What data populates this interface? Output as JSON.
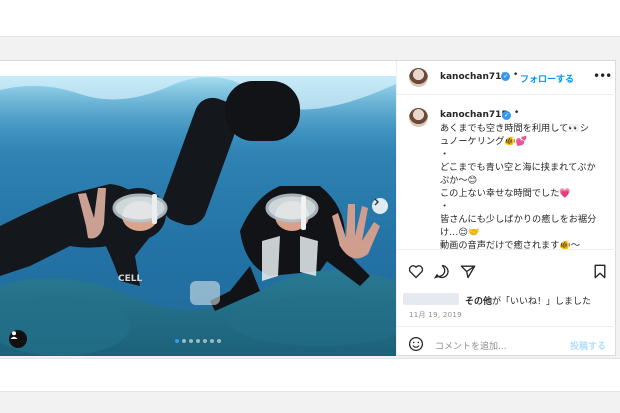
{
  "post": {
    "username": "kanochan715",
    "dot": "•",
    "follow_label": "フォローする",
    "more_label": "•••",
    "caption_lines": [
      "あくまでも空き時間を利用して👀シ",
      "ュノーケリング🐠💕",
      "・",
      "どこまでも青い空と海に挟まれてぷか",
      "ぷか〜😊",
      "この上ない幸せな時間でした💗",
      "・",
      "皆さんにも少しばかりの癒しをお裾分",
      "け…😌🤝",
      "動画の音声だけで癒されます🐠〜",
      "・"
    ],
    "likes_prefix": "その他",
    "likes_suffix": "が「いいね！」しました",
    "date": "11月 19, 2019",
    "comment_placeholder": "コメントを追加...",
    "post_label": "投稿する",
    "photo_brand_text": "CELL",
    "carousel_count": 7,
    "carousel_active": 1
  },
  "icons": {
    "verified": "verified-badge-icon",
    "like": "heart-icon",
    "comment": "comment-icon",
    "share": "paper-plane-icon",
    "save": "bookmark-icon",
    "emoji": "emoji-icon",
    "next": "chevron-right-icon",
    "tagged": "user-tag-icon"
  },
  "colors": {
    "accent": "#0095f6",
    "post_disabled": "#b2dffc",
    "verified": "#3897f0",
    "water": "#2a7db0"
  }
}
